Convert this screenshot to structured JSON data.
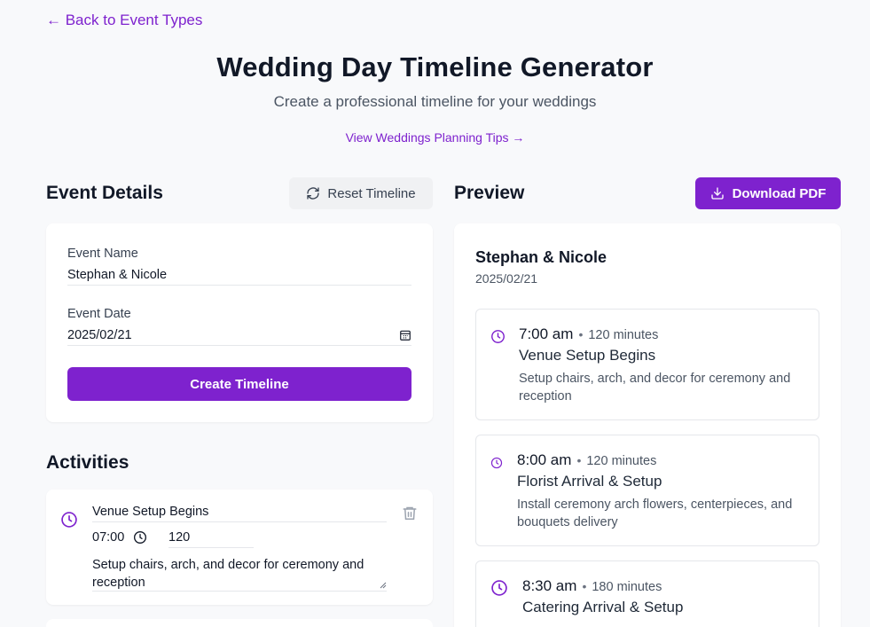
{
  "nav": {
    "back_label": "← Back to Event Types"
  },
  "header": {
    "title": "Wedding Day Timeline Generator",
    "subtitle": "Create a professional timeline for your weddings",
    "tips_link": "View Weddings Planning Tips →"
  },
  "event_details": {
    "heading": "Event Details",
    "reset_label": "Reset Timeline",
    "name_label": "Event Name",
    "name_value": "Stephan & Nicole",
    "date_label": "Event Date",
    "date_value": "2025/02/21",
    "create_label": "Create Timeline"
  },
  "activities": {
    "heading": "Activities",
    "items": [
      {
        "title": "Venue Setup Begins",
        "time": "07:00",
        "duration": "120",
        "description": "Setup chairs, arch, and decor for ceremony and reception"
      }
    ]
  },
  "preview": {
    "heading": "Preview",
    "download_label": "Download PDF",
    "event_name": "Stephan & Nicole",
    "event_date": "2025/02/21",
    "items": [
      {
        "time": "7:00 am",
        "duration": "120 minutes",
        "title": "Venue Setup Begins",
        "description": "Setup chairs, arch, and decor for ceremony and reception"
      },
      {
        "time": "8:00 am",
        "duration": "120 minutes",
        "title": "Florist Arrival & Setup",
        "description": "Install ceremony arch flowers, centerpieces, and bouquets delivery"
      },
      {
        "time": "8:30 am",
        "duration": "180 minutes",
        "title": "Catering Arrival & Setup",
        "description": ""
      }
    ]
  },
  "colors": {
    "accent": "#7e22ce",
    "text": "#111827",
    "muted": "#4b5563",
    "background": "#f8f9fb"
  },
  "icons": [
    "arrow-left-icon",
    "refresh-icon",
    "download-icon",
    "calendar-icon",
    "clock-icon",
    "trash-icon"
  ]
}
